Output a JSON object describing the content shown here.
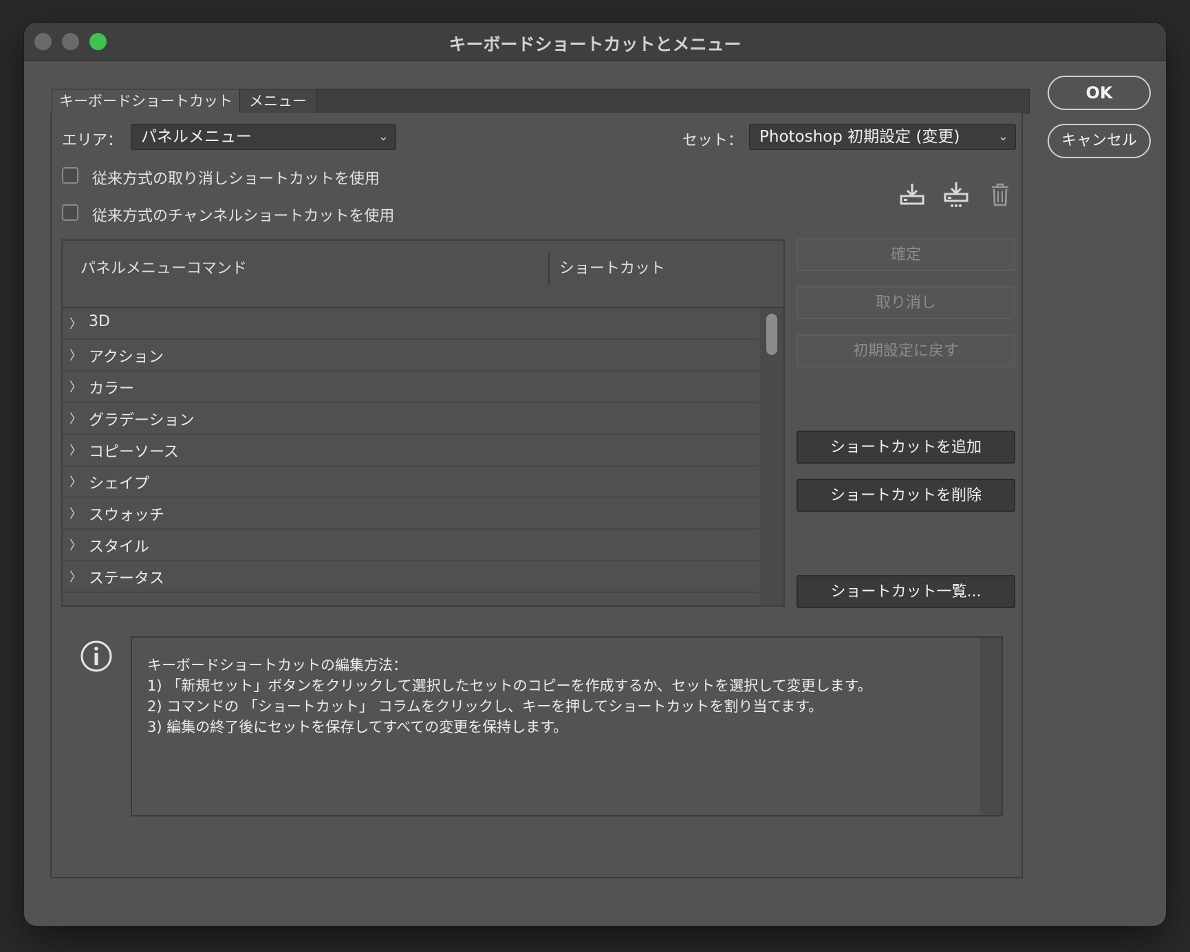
{
  "window": {
    "title": "キーボードショートカットとメニュー"
  },
  "tabs": [
    {
      "label": "キーボードショートカット",
      "active": true
    },
    {
      "label": "メニュー",
      "active": false
    }
  ],
  "area": {
    "label": "エリア：",
    "value": "パネルメニュー"
  },
  "set": {
    "label": "セット：",
    "value": "Photoshop 初期設定 (変更)"
  },
  "options": {
    "legacy_undo": {
      "label": "従来方式の取り消しショートカットを使用",
      "checked": false
    },
    "legacy_channel": {
      "label": "従来方式のチャンネルショートカットを使用",
      "checked": false
    }
  },
  "set_actions": {
    "save_icon": "save-set-icon",
    "new_set_icon": "new-set-icon",
    "delete_icon": "trash-icon"
  },
  "table": {
    "columns": [
      "パネルメニューコマンド",
      "ショートカット"
    ],
    "rows": [
      "3D",
      "アクション",
      "カラー",
      "グラデーション",
      "コピーソース",
      "シェイプ",
      "スウォッチ",
      "スタイル",
      "ステータス"
    ]
  },
  "side_buttons": {
    "accept": "確定",
    "undo": "取り消し",
    "use_default": "初期設定に戻す",
    "add_shortcut": "ショートカットを追加",
    "delete_shortcut": "ショートカットを削除",
    "summarize": "ショートカット一覧..."
  },
  "dialog_buttons": {
    "ok": "OK",
    "cancel": "キャンセル"
  },
  "info": {
    "lines": [
      "キーボードショートカットの編集方法：",
      "1) 「新規セット」ボタンをクリックして選択したセットのコピーを作成するか、セットを選択して変更します。",
      "2) コマンドの 「ショートカット」 コラムをクリックし、キーを押してショートカットを割り当てます。",
      "3) 編集の終了後にセットを保存してすべての変更を保持します。"
    ]
  },
  "colors": {
    "window_bg": "#535353",
    "titlebar": "#3f3f3f",
    "maximize": "#3fc24f"
  }
}
